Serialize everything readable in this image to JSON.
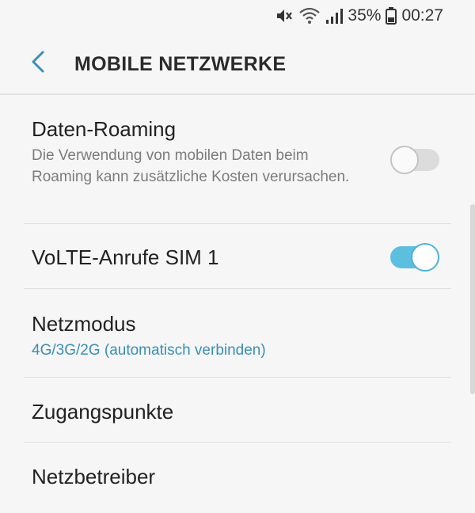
{
  "status_bar": {
    "icons": [
      "mute-icon",
      "wifi-icon",
      "signal-icon",
      "battery-icon"
    ],
    "battery": "35%",
    "time": "00:27"
  },
  "header": {
    "back_icon": "chevron-left-icon",
    "title": "MOBILE NETZWERKE"
  },
  "settings": {
    "data_roaming": {
      "title": "Daten-Roaming",
      "description": "Die Verwendung von mobilen Daten beim Roaming kann zusätzliche Kosten verursachen.",
      "enabled": false
    },
    "volte": {
      "title": "VoLTE-Anrufe SIM 1",
      "enabled": true
    },
    "network_mode": {
      "title": "Netzmodus",
      "value": "4G/3G/2G (automatisch verbinden)"
    },
    "access_points": {
      "title": "Zugangspunkte"
    },
    "network_operators": {
      "title": "Netzbetreiber"
    }
  },
  "colors": {
    "accent": "#3a8eb6",
    "toggle_on": "#5cbfe0",
    "toggle_off": "#dcdcdc",
    "background": "#f6f6f6"
  }
}
